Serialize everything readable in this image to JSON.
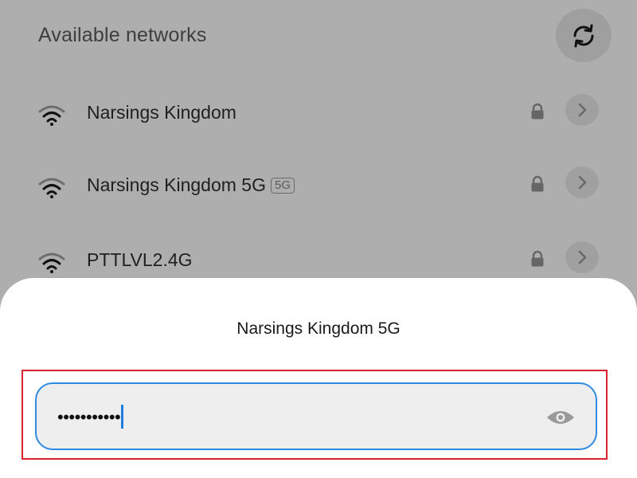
{
  "header": {
    "title": "Available networks"
  },
  "networks": [
    {
      "name": "Narsings Kingdom",
      "badge": "",
      "secured": true
    },
    {
      "name": "Narsings Kingdom 5G",
      "badge": "5G",
      "secured": true
    },
    {
      "name": "PTTLVL2.4G",
      "badge": "",
      "secured": true
    }
  ],
  "dialog": {
    "title": "Narsings Kingdom 5G",
    "password_masked": "•••••••••••"
  },
  "colors": {
    "overlay_bg": "#aeaeae",
    "sheet_bg": "#ffffff",
    "field_border": "#2f8be0",
    "highlight": "#d9222c"
  },
  "icons": [
    "refresh-icon",
    "wifi-icon",
    "lock-icon",
    "chevron-right-icon",
    "eye-icon"
  ]
}
